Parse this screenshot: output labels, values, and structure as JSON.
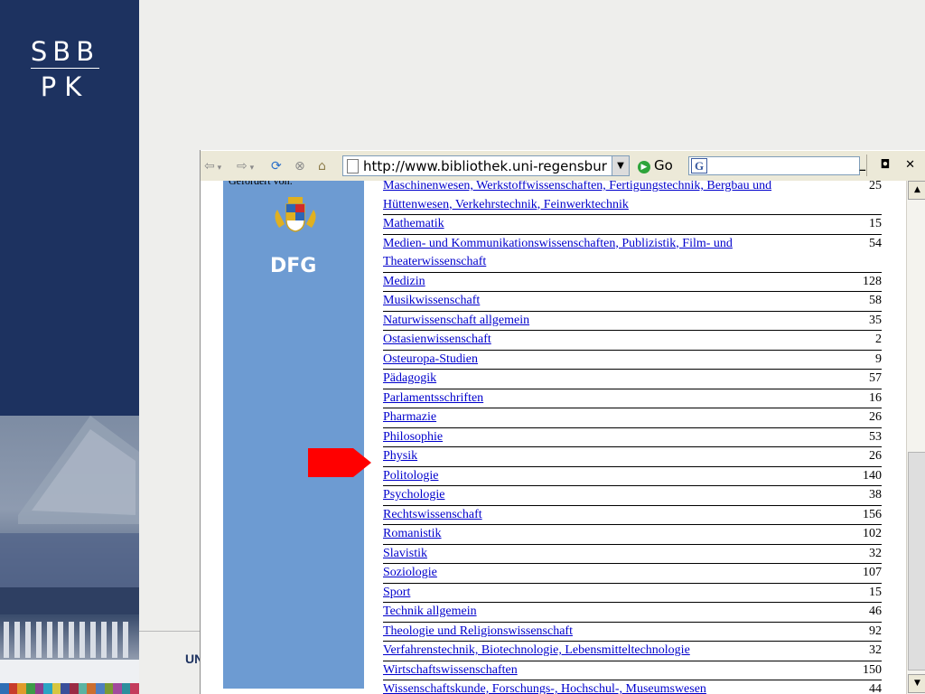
{
  "slide": {
    "logo_top": "SBB",
    "logo_bottom": "PK",
    "footer_text": "UN",
    "color_strip": [
      "#2f6fb5",
      "#c83c2a",
      "#e09b2a",
      "#3d9b48",
      "#8c3e8f",
      "#2ba5c4",
      "#d7c640",
      "#3a4f9a",
      "#9a2b44",
      "#5bb3a2",
      "#cb6e2f",
      "#4d7ec0",
      "#7a9a33",
      "#a14a9c",
      "#2d8f9d",
      "#c43c5d"
    ]
  },
  "browser": {
    "address_value": "http://www.bibliothek.uni-regensburg",
    "go_label": "Go",
    "search_value": "",
    "win_controls": "_ ◘ ✕"
  },
  "sidebar": {
    "sponsor_text": "Gefördert von:"
  },
  "subjects": [
    {
      "name": "Maschinenwesen, Werkstoffwissenschaften, Fertigungstechnik, Bergbau und Hüttenwesen, Verkehrstechnik, Feinwerktechnik",
      "count": "25"
    },
    {
      "name": "Mathematik",
      "count": "15"
    },
    {
      "name": "Medien- und Kommunikationswissenschaften, Publizistik, Film- und Theaterwissenschaft",
      "count": "54"
    },
    {
      "name": "Medizin",
      "count": "128"
    },
    {
      "name": "Musikwissenschaft",
      "count": "58"
    },
    {
      "name": "Naturwissenschaft allgemein",
      "count": "35"
    },
    {
      "name": "Ostasienwissenschaft",
      "count": "2"
    },
    {
      "name": "Osteuropa-Studien",
      "count": "9"
    },
    {
      "name": "Pädagogik",
      "count": "57"
    },
    {
      "name": "Parlamentsschriften",
      "count": "16"
    },
    {
      "name": "Pharmazie",
      "count": "26"
    },
    {
      "name": "Philosophie",
      "count": "53"
    },
    {
      "name": "Physik",
      "count": "26"
    },
    {
      "name": "Politologie",
      "count": "140"
    },
    {
      "name": "Psychologie",
      "count": "38"
    },
    {
      "name": "Rechtswissenschaft",
      "count": "156"
    },
    {
      "name": "Romanistik",
      "count": "102"
    },
    {
      "name": "Slavistik",
      "count": "32"
    },
    {
      "name": "Soziologie",
      "count": "107"
    },
    {
      "name": "Sport",
      "count": "15"
    },
    {
      "name": "Technik allgemein",
      "count": "46"
    },
    {
      "name": "Theologie und Religionswissenschaft",
      "count": "92"
    },
    {
      "name": "Verfahrenstechnik, Biotechnologie, Lebensmitteltechnologie",
      "count": "32"
    },
    {
      "name": "Wirtschaftswissenschaften",
      "count": "150"
    },
    {
      "name": "Wissenschaftskunde, Forschungs-, Hochschul-, Museumswesen",
      "count": "44"
    }
  ],
  "icons": {
    "dfg": "DFG"
  },
  "colors": {
    "slide_navy": "#1d3260",
    "sidebar_blue": "#6d9bd2",
    "link_blue": "#0000cc",
    "arrow_red": "#ff0000"
  }
}
